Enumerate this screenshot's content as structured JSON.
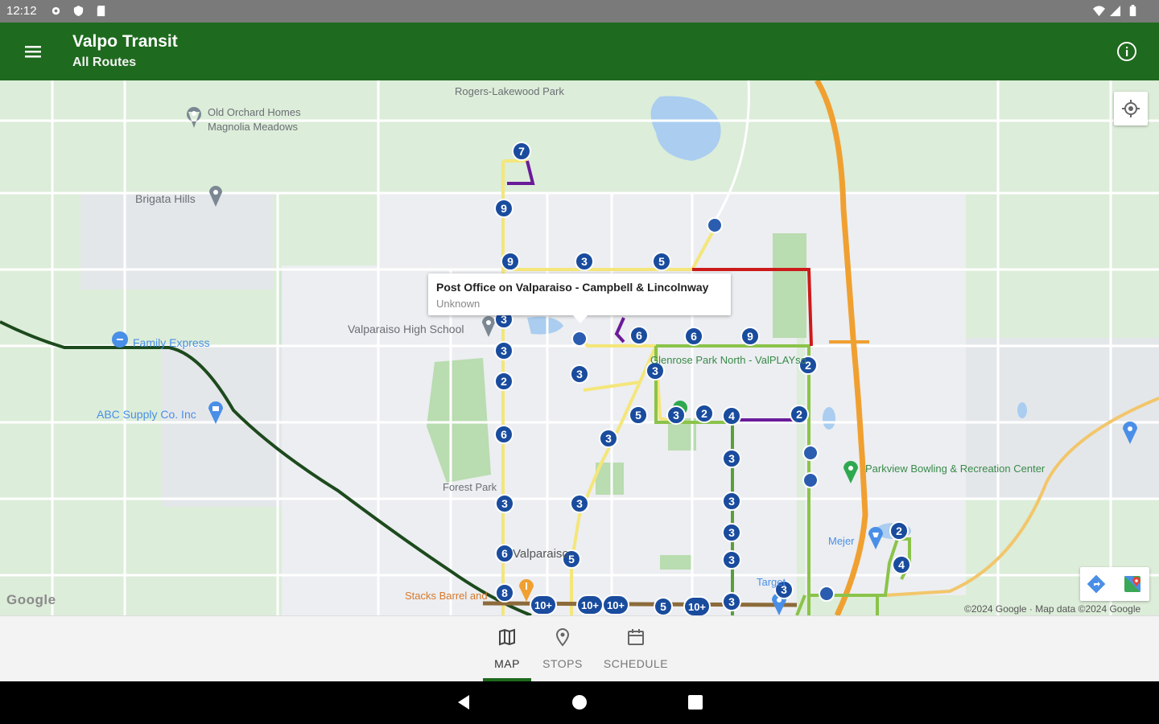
{
  "status_bar": {
    "time": "12:12"
  },
  "app_bar": {
    "title": "Valpo Transit",
    "subtitle": "All Routes"
  },
  "map": {
    "place_labels": [
      "Rogers-Lakewood Park",
      "Old Orchard Homes",
      "Magnolia Meadows",
      "Brigata Hills",
      "Family Express",
      "Valparaiso High School",
      "ABC Supply Co. Inc",
      "Forest Park",
      "Valparaiso",
      "Stacks Barrel and",
      "Mejer",
      "Target",
      "Parkview Bowling & Recreation Center",
      "Glenrose Park North - ValPLAYso"
    ],
    "route_colors": {
      "1": "#1d4a1d",
      "2": "#8bc34a",
      "3": "#f4e67a",
      "5": "#cc1a1a",
      "7": "#6a1b9a",
      "highway": "#f0a030",
      "stop": "#1a4c9e"
    },
    "stop_badges": [
      "7",
      "9",
      "9",
      "3",
      "5",
      "3",
      "3",
      "2",
      "6",
      "3",
      "6",
      "6",
      "9",
      "3",
      "3",
      "2",
      "5",
      "3",
      "2",
      "4",
      "2",
      "2",
      "3",
      "3",
      "3",
      "3",
      "3",
      "3",
      "3",
      "2",
      "4",
      "5",
      "6",
      "8",
      "10+",
      "10+",
      "10+",
      "5",
      "10+",
      "3"
    ],
    "popup": {
      "title": "Post Office on Valparaiso - Campbell & Lincolnway",
      "subtitle": "Unknown"
    },
    "attribution": "©2024 Google · Map data ©2024 Google",
    "logo": "Google"
  },
  "bottom_nav": {
    "items": [
      {
        "label": "MAP",
        "icon": "map-icon",
        "selected": true
      },
      {
        "label": "STOPS",
        "icon": "location-pin-icon",
        "selected": false
      },
      {
        "label": "SCHEDULE",
        "icon": "calendar-icon",
        "selected": false
      }
    ]
  },
  "system_nav": {
    "buttons": [
      "back",
      "home",
      "recents"
    ]
  }
}
